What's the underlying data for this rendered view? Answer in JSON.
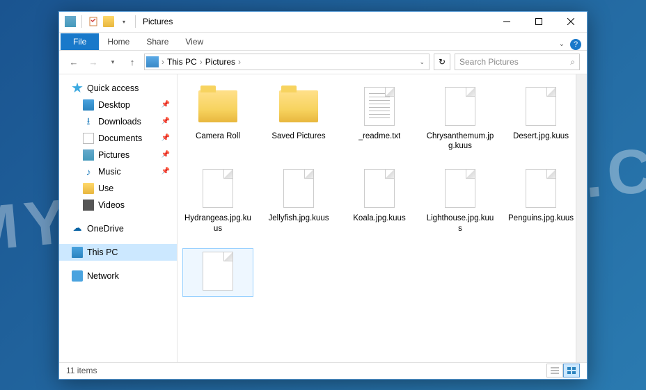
{
  "window": {
    "title": "Pictures"
  },
  "ribbon": {
    "file": "File",
    "tabs": [
      "Home",
      "Share",
      "View"
    ]
  },
  "nav": {
    "breadcrumb": [
      "This PC",
      "Pictures"
    ],
    "search_placeholder": "Search Pictures"
  },
  "sidebar": {
    "quick_access": "Quick access",
    "items": [
      {
        "label": "Desktop",
        "icon": "monitor",
        "pinned": true
      },
      {
        "label": "Downloads",
        "icon": "download",
        "pinned": true
      },
      {
        "label": "Documents",
        "icon": "doc",
        "pinned": true
      },
      {
        "label": "Pictures",
        "icon": "pic",
        "pinned": true
      },
      {
        "label": "Music",
        "icon": "music",
        "pinned": true
      },
      {
        "label": "Use",
        "icon": "folder",
        "pinned": false
      },
      {
        "label": "Videos",
        "icon": "video",
        "pinned": false
      }
    ],
    "onedrive": "OneDrive",
    "thispc": "This PC",
    "network": "Network"
  },
  "files": [
    {
      "name": "Camera Roll",
      "type": "folder"
    },
    {
      "name": "Saved Pictures",
      "type": "folder"
    },
    {
      "name": "_readme.txt",
      "type": "txt"
    },
    {
      "name": "Chrysanthemum.jpg.kuus",
      "type": "file"
    },
    {
      "name": "Desert.jpg.kuus",
      "type": "file"
    },
    {
      "name": "Hydrangeas.jpg.kuus",
      "type": "file"
    },
    {
      "name": "Jellyfish.jpg.kuus",
      "type": "file"
    },
    {
      "name": "Koala.jpg.kuus",
      "type": "file"
    },
    {
      "name": "Lighthouse.jpg.kuus",
      "type": "file"
    },
    {
      "name": "Penguins.jpg.kuus",
      "type": "file"
    },
    {
      "name": "",
      "type": "file",
      "selected": true
    }
  ],
  "status": {
    "count": "11 items"
  }
}
